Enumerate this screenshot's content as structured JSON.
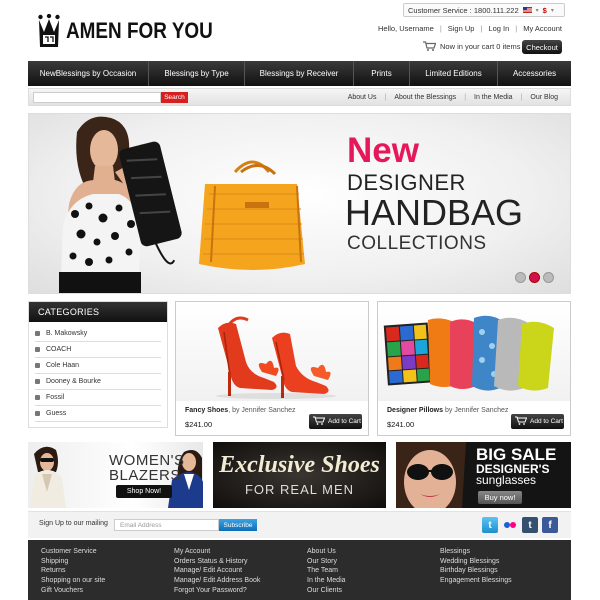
{
  "brand": {
    "name": "AMEN FOR YOU"
  },
  "top": {
    "service_label": "Customer Service : 1800.111.222",
    "currency": "$",
    "user": "Hello, Username",
    "signup": "Sign Up",
    "login": "Log In",
    "account": "My Account",
    "cart_text": "Now in your cart 0 items",
    "checkout": "Checkout"
  },
  "nav": {
    "items": [
      {
        "label": "NewBlessings by Occasion"
      },
      {
        "label": "Blessings by Type"
      },
      {
        "label": "Blessings by Receiver"
      },
      {
        "label": "Prints"
      },
      {
        "label": "Limited Editions"
      },
      {
        "label": "Accessories"
      }
    ]
  },
  "subbar": {
    "search_button": "Search",
    "links": [
      "About Us",
      "About the Blessings",
      "In the Media",
      "Our Blog"
    ]
  },
  "hero": {
    "line_new": "New",
    "line1": "DESIGNER",
    "line2": "HANDBAG",
    "line3": "COLLECTIONS",
    "slides": 3,
    "active_slide": 2
  },
  "categories": {
    "title": "CATEGORIES",
    "items": [
      "B. Makowsky",
      "COACH",
      "Cole Haan",
      "Dooney & Bourke",
      "Fossil",
      "Guess"
    ]
  },
  "products": [
    {
      "name": "Fancy Shoes",
      "by": ", by Jennifer Sanchez",
      "price": "$241.00",
      "button": "Add to Cart"
    },
    {
      "name": "Designer Pillows",
      "by": " by Jennifer Sanchez",
      "price": "$241.00",
      "button": "Add to Cart"
    }
  ],
  "banners": {
    "womens": {
      "line1": "WOMEN'S",
      "line2": "BLAZERS",
      "button": "Shop Now!"
    },
    "shoes": {
      "line1": "Exclusive Shoes",
      "line2": "FOR REAL MEN"
    },
    "sale": {
      "line1": "BIG SALE",
      "line2": "DESIGNER'S",
      "line3": "sunglasses",
      "button": "Buy now!"
    }
  },
  "mailing": {
    "label": "Sign Up to our mailing",
    "placeholder": "Email Address",
    "button": "Subscribe",
    "social_icons": [
      "twitter-icon",
      "flickr-icon",
      "tumblr-icon",
      "facebook-icon"
    ]
  },
  "footer": {
    "col1": [
      "Customer Service",
      "Shipping",
      "Returns",
      "Shopping on our site",
      "Gift Vouchers"
    ],
    "col2": [
      "My Account",
      "Orders Status & History",
      "Manage/ Edit Account",
      "Manage/ Edit Address Book",
      "Forgot Your Password?"
    ],
    "col3": [
      "About Us",
      "Our Story",
      "The Team",
      "In the Media",
      "Our Clients"
    ],
    "col4": [
      "Blessings",
      "Wedding Blessings",
      "Birthday Blessings",
      "Engagement Blessings"
    ]
  },
  "colors": {
    "accent_pink": "#e5185a",
    "search_red": "#d62020",
    "subscribe_blue": "#1a7cc7",
    "nav_dark": "#1a1a1a"
  }
}
